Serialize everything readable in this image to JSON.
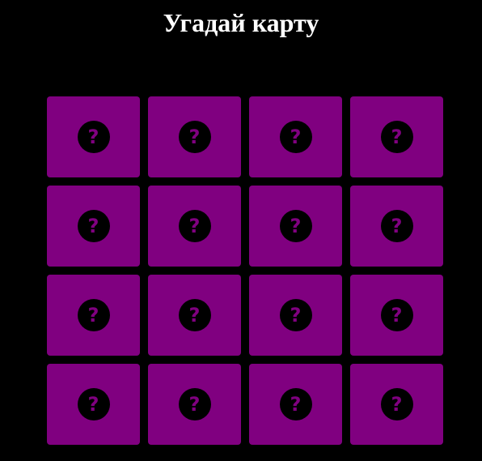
{
  "title": "Угадай карту",
  "colors": {
    "background": "#000000",
    "title": "#ffffff",
    "card_back": "#800080",
    "badge": "#000000",
    "badge_glyph": "#800080"
  },
  "board": {
    "rows": 4,
    "columns": 4,
    "cards": [
      {
        "face": "?",
        "icon": "question-mark-icon"
      },
      {
        "face": "?",
        "icon": "question-mark-icon"
      },
      {
        "face": "?",
        "icon": "question-mark-icon"
      },
      {
        "face": "?",
        "icon": "question-mark-icon"
      },
      {
        "face": "?",
        "icon": "question-mark-icon"
      },
      {
        "face": "?",
        "icon": "question-mark-icon"
      },
      {
        "face": "?",
        "icon": "question-mark-icon"
      },
      {
        "face": "?",
        "icon": "question-mark-icon"
      },
      {
        "face": "?",
        "icon": "question-mark-icon"
      },
      {
        "face": "?",
        "icon": "question-mark-icon"
      },
      {
        "face": "?",
        "icon": "question-mark-icon"
      },
      {
        "face": "?",
        "icon": "question-mark-icon"
      },
      {
        "face": "?",
        "icon": "question-mark-icon"
      },
      {
        "face": "?",
        "icon": "question-mark-icon"
      },
      {
        "face": "?",
        "icon": "question-mark-icon"
      },
      {
        "face": "?",
        "icon": "question-mark-icon"
      }
    ]
  }
}
